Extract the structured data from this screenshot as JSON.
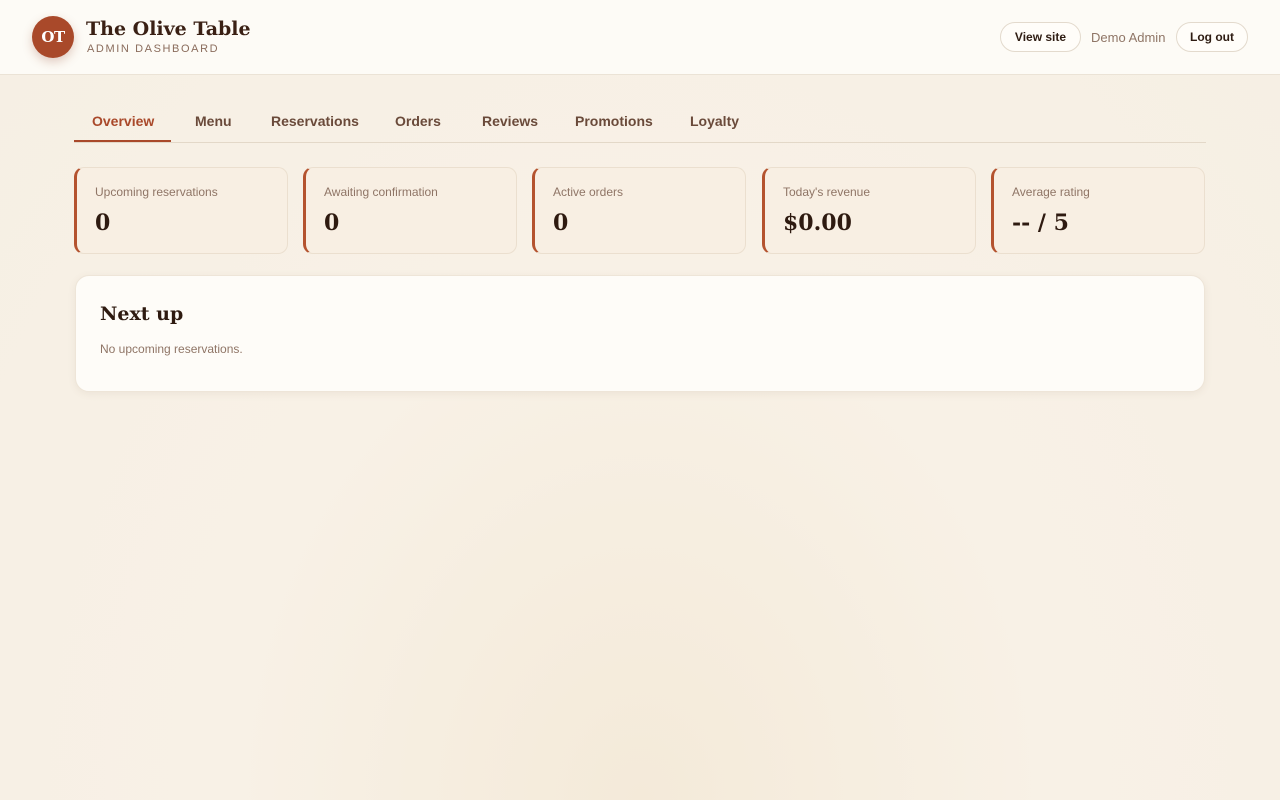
{
  "header": {
    "logo_initials": "OT",
    "title": "The Olive Table",
    "subtitle": "ADMIN DASHBOARD",
    "view_site_label": "View site",
    "user_name": "Demo Admin",
    "logout_label": "Log out"
  },
  "tabs": [
    {
      "label": "Overview",
      "active": true
    },
    {
      "label": "Menu"
    },
    {
      "label": "Reservations"
    },
    {
      "label": "Orders"
    },
    {
      "label": "Reviews"
    },
    {
      "label": "Promotions"
    },
    {
      "label": "Loyalty"
    }
  ],
  "stats": [
    {
      "label": "Upcoming reservations",
      "value": "0"
    },
    {
      "label": "Awaiting confirmation",
      "value": "0"
    },
    {
      "label": "Active orders",
      "value": "0"
    },
    {
      "label": "Today's revenue",
      "value": "$0.00"
    },
    {
      "label": "Average rating",
      "value": "-- / 5"
    }
  ],
  "next_up": {
    "title": "Next up",
    "empty_text": "No upcoming reservations."
  },
  "colors": {
    "accent": "#a9492a",
    "background": "#f8f1e6",
    "text": "#2e1a10"
  }
}
